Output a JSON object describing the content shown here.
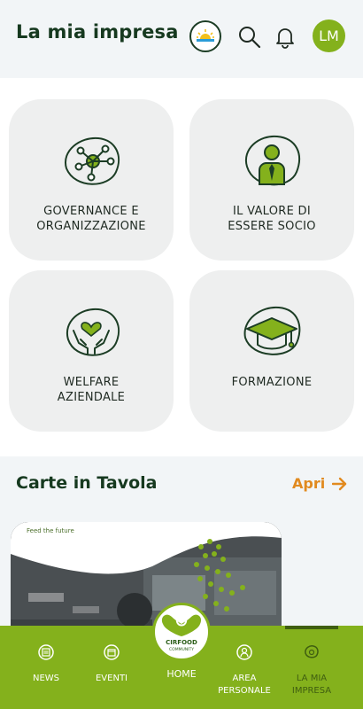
{
  "header": {
    "title": "La mia impresa",
    "avatar_initials": "LM",
    "icons": [
      "weather-sun-icon",
      "search-icon",
      "bell-icon"
    ]
  },
  "tiles": [
    {
      "label": "GOVERNANCE E ORGANIZZAZIONE",
      "icon": "network-icon"
    },
    {
      "label": "IL VALORE DI ESSERE SOCIO",
      "icon": "member-person-icon"
    },
    {
      "label": "WELFARE AZIENDALE",
      "icon": "heart-hands-icon"
    },
    {
      "label": "FORMAZIONE",
      "icon": "graduation-cap-icon"
    }
  ],
  "section": {
    "title": "Carte in Tavola",
    "open_label": "Apri",
    "card_tagline": "Feed the future"
  },
  "nav": {
    "items": [
      {
        "label": "NEWS",
        "icon": "news-icon"
      },
      {
        "label": "EVENTI",
        "icon": "calendar-icon"
      },
      {
        "label": "HOME",
        "icon": "cirfood-logo"
      },
      {
        "label": "AREA PERSONALE",
        "icon": "person-icon"
      },
      {
        "label": "LA MIA IMPRESA",
        "icon": "company-icon"
      }
    ],
    "active": "LA MIA IMPRESA",
    "home_logo_text": "CIRFOOD",
    "home_logo_sub": "COMMUNITY"
  },
  "colors": {
    "brand_green": "#84b11c",
    "dark_green": "#16391f",
    "accent_orange": "#e18a1f",
    "tile_bg": "#eeefef"
  }
}
